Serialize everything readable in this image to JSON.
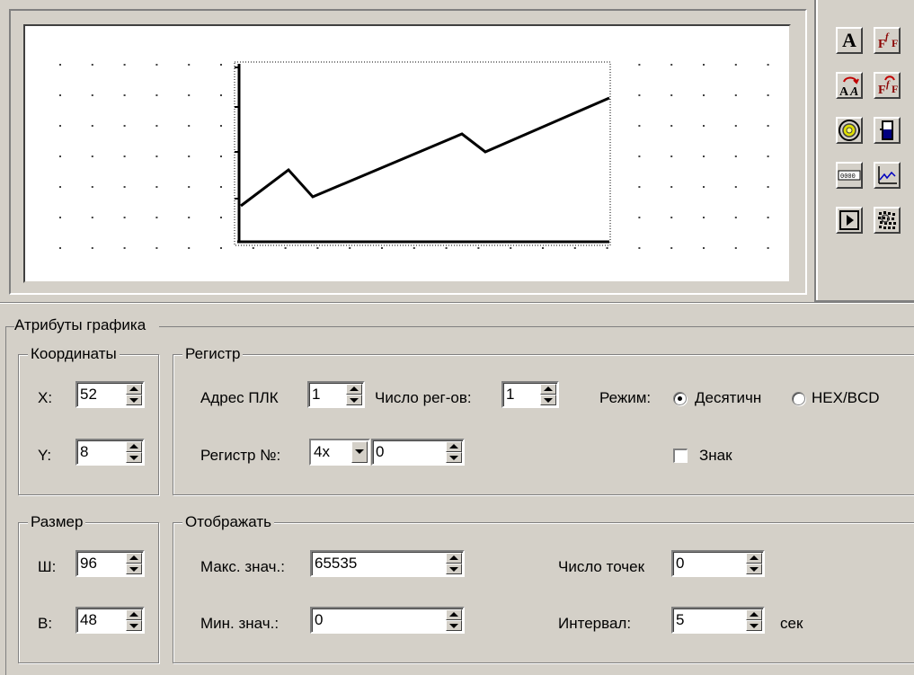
{
  "toolbox": {
    "tools": [
      {
        "name": "text-tool",
        "glyph": "A"
      },
      {
        "name": "font-tool",
        "glyph": "F"
      },
      {
        "name": "text-swap-tool",
        "glyph": "AA"
      },
      {
        "name": "font-swap-tool",
        "glyph": "F"
      },
      {
        "name": "lamp-tool",
        "glyph": ""
      },
      {
        "name": "register-tool",
        "glyph": ""
      },
      {
        "name": "display-tool",
        "glyph": ""
      },
      {
        "name": "chart-tool",
        "glyph": ""
      },
      {
        "name": "play-tool",
        "glyph": ""
      },
      {
        "name": "misc-tool",
        "glyph": ""
      }
    ]
  },
  "attributes": {
    "title": "Атрибуты графика",
    "coordinates": {
      "title": "Координаты",
      "x_label": "X:",
      "x_value": "52",
      "y_label": "Y:",
      "y_value": "8"
    },
    "size": {
      "title": "Размер",
      "w_label": "Ш:",
      "w_value": "96",
      "h_label": "В:",
      "h_value": "48"
    },
    "register": {
      "title": "Регистр",
      "plc_address_label": "Адрес ПЛК",
      "plc_address_value": "1",
      "reg_count_label": "Число рег-ов:",
      "reg_count_value": "1",
      "mode_label": "Режим:",
      "mode_decimal": "Десятичн",
      "mode_hex": "HEX/BCD",
      "mode_selected": "decimal",
      "register_num_label": "Регистр №:",
      "register_type": "4x",
      "register_num_value": "0",
      "sign_label": "Знак",
      "sign_checked": false
    },
    "display": {
      "title": "Отображать",
      "max_label": "Макс. знач.:",
      "max_value": "65535",
      "min_label": "Мин. знач.:",
      "min_value": "0",
      "points_label": "Число точек",
      "points_value": "0",
      "interval_label": "Интервал:",
      "interval_value": "5",
      "interval_unit": "сек"
    }
  }
}
